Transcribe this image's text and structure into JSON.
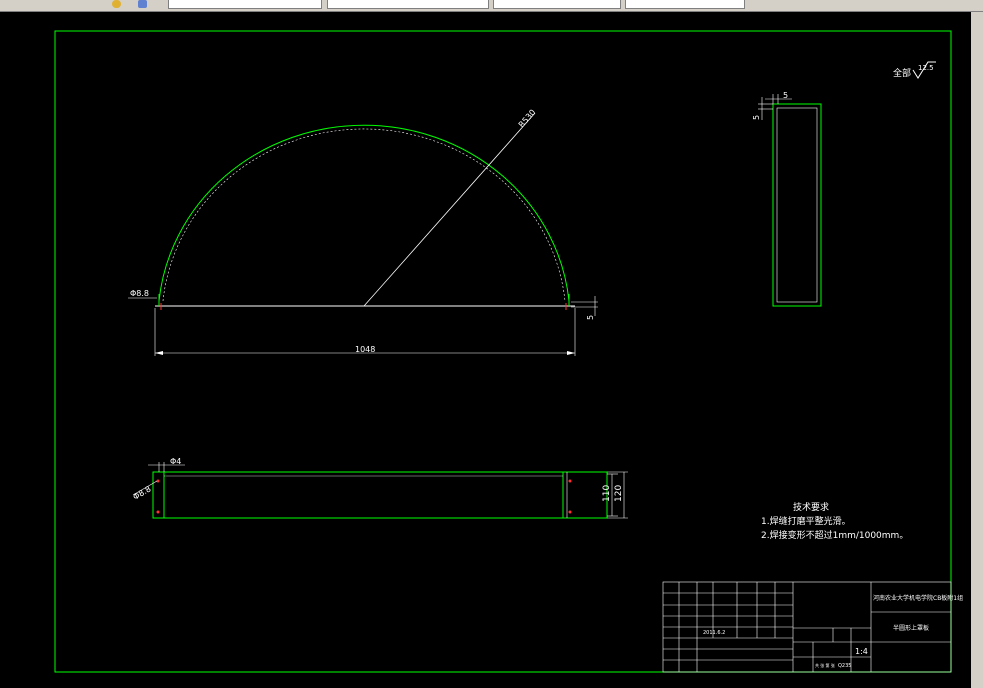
{
  "toolbar": {
    "segments": [
      "",
      "",
      "",
      "",
      ""
    ],
    "icons": [
      "app-icon",
      "shape-icon"
    ]
  },
  "drawing": {
    "roughness_label": "全部",
    "roughness_value": "12.5",
    "front_view": {
      "radius_label": "R530",
      "hole_label": "Φ8.8",
      "thickness_label": "5",
      "width_label": "1048"
    },
    "side_view": {
      "top_label": "5",
      "left_label": "5"
    },
    "bottom_view": {
      "top_label": "Φ4",
      "hole_label": "Φ8.8",
      "inner_height_label": "110",
      "outer_height_label": "120"
    },
    "tech_requirements": {
      "title": "技术要求",
      "line1": "1.焊缝打磨平整光滑。",
      "line2": "2.焊接变形不超过1mm/1000mm。"
    },
    "title_block": {
      "school": "河南农业大学机电学院CB板附1组",
      "part_name": "半圆形上罩板",
      "scale": "1:4",
      "date": "2011.6.2",
      "material": "Q235",
      "sheet": "共 张 第 张"
    }
  },
  "colors": {
    "background": "#000000",
    "frame": "#00ff00",
    "geometry": "#ffffff",
    "marker": "#ff3030"
  }
}
